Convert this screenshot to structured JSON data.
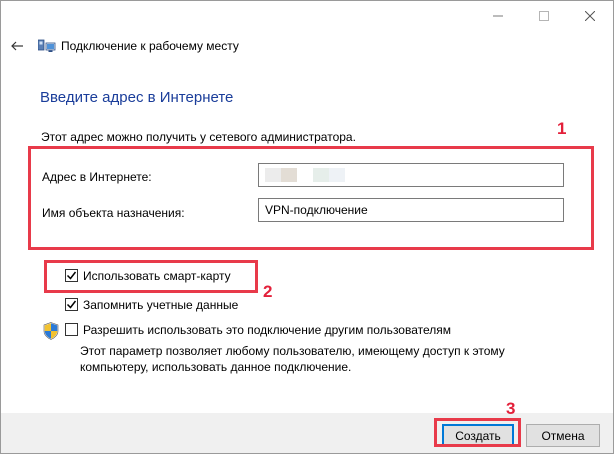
{
  "window": {
    "title": "Подключение к рабочему месту",
    "controls": [
      "minimize-icon",
      "maximize-icon",
      "close-icon"
    ]
  },
  "page": {
    "heading": "Введите адрес в Интернете",
    "hint": "Этот адрес можно получить у сетевого администратора."
  },
  "fields": {
    "address_label": "Адрес в Интернете:",
    "address_value": "",
    "destination_label": "Имя объекта назначения:",
    "destination_value": "VPN-подключение"
  },
  "options": {
    "smartcard_label": "Использовать смарт-карту",
    "smartcard_checked": true,
    "remember_label": "Запомнить учетные данные",
    "remember_checked": true,
    "share_label": "Разрешить использовать это подключение другим пользователям",
    "share_checked": false,
    "share_desc_line1": "Этот параметр позволяет любому пользователю, имеющему доступ к этому",
    "share_desc_line2": "компьютеру, использовать данное подключение."
  },
  "annotations": {
    "badge_1": "1",
    "badge_2": "2",
    "badge_3": "3",
    "color": "#e83a4a"
  },
  "buttons": {
    "create": "Создать",
    "cancel": "Отмена"
  },
  "colors": {
    "heading": "#1a3d9a",
    "primary_border": "#0078d7",
    "footer_bg": "#f0f0f0"
  }
}
